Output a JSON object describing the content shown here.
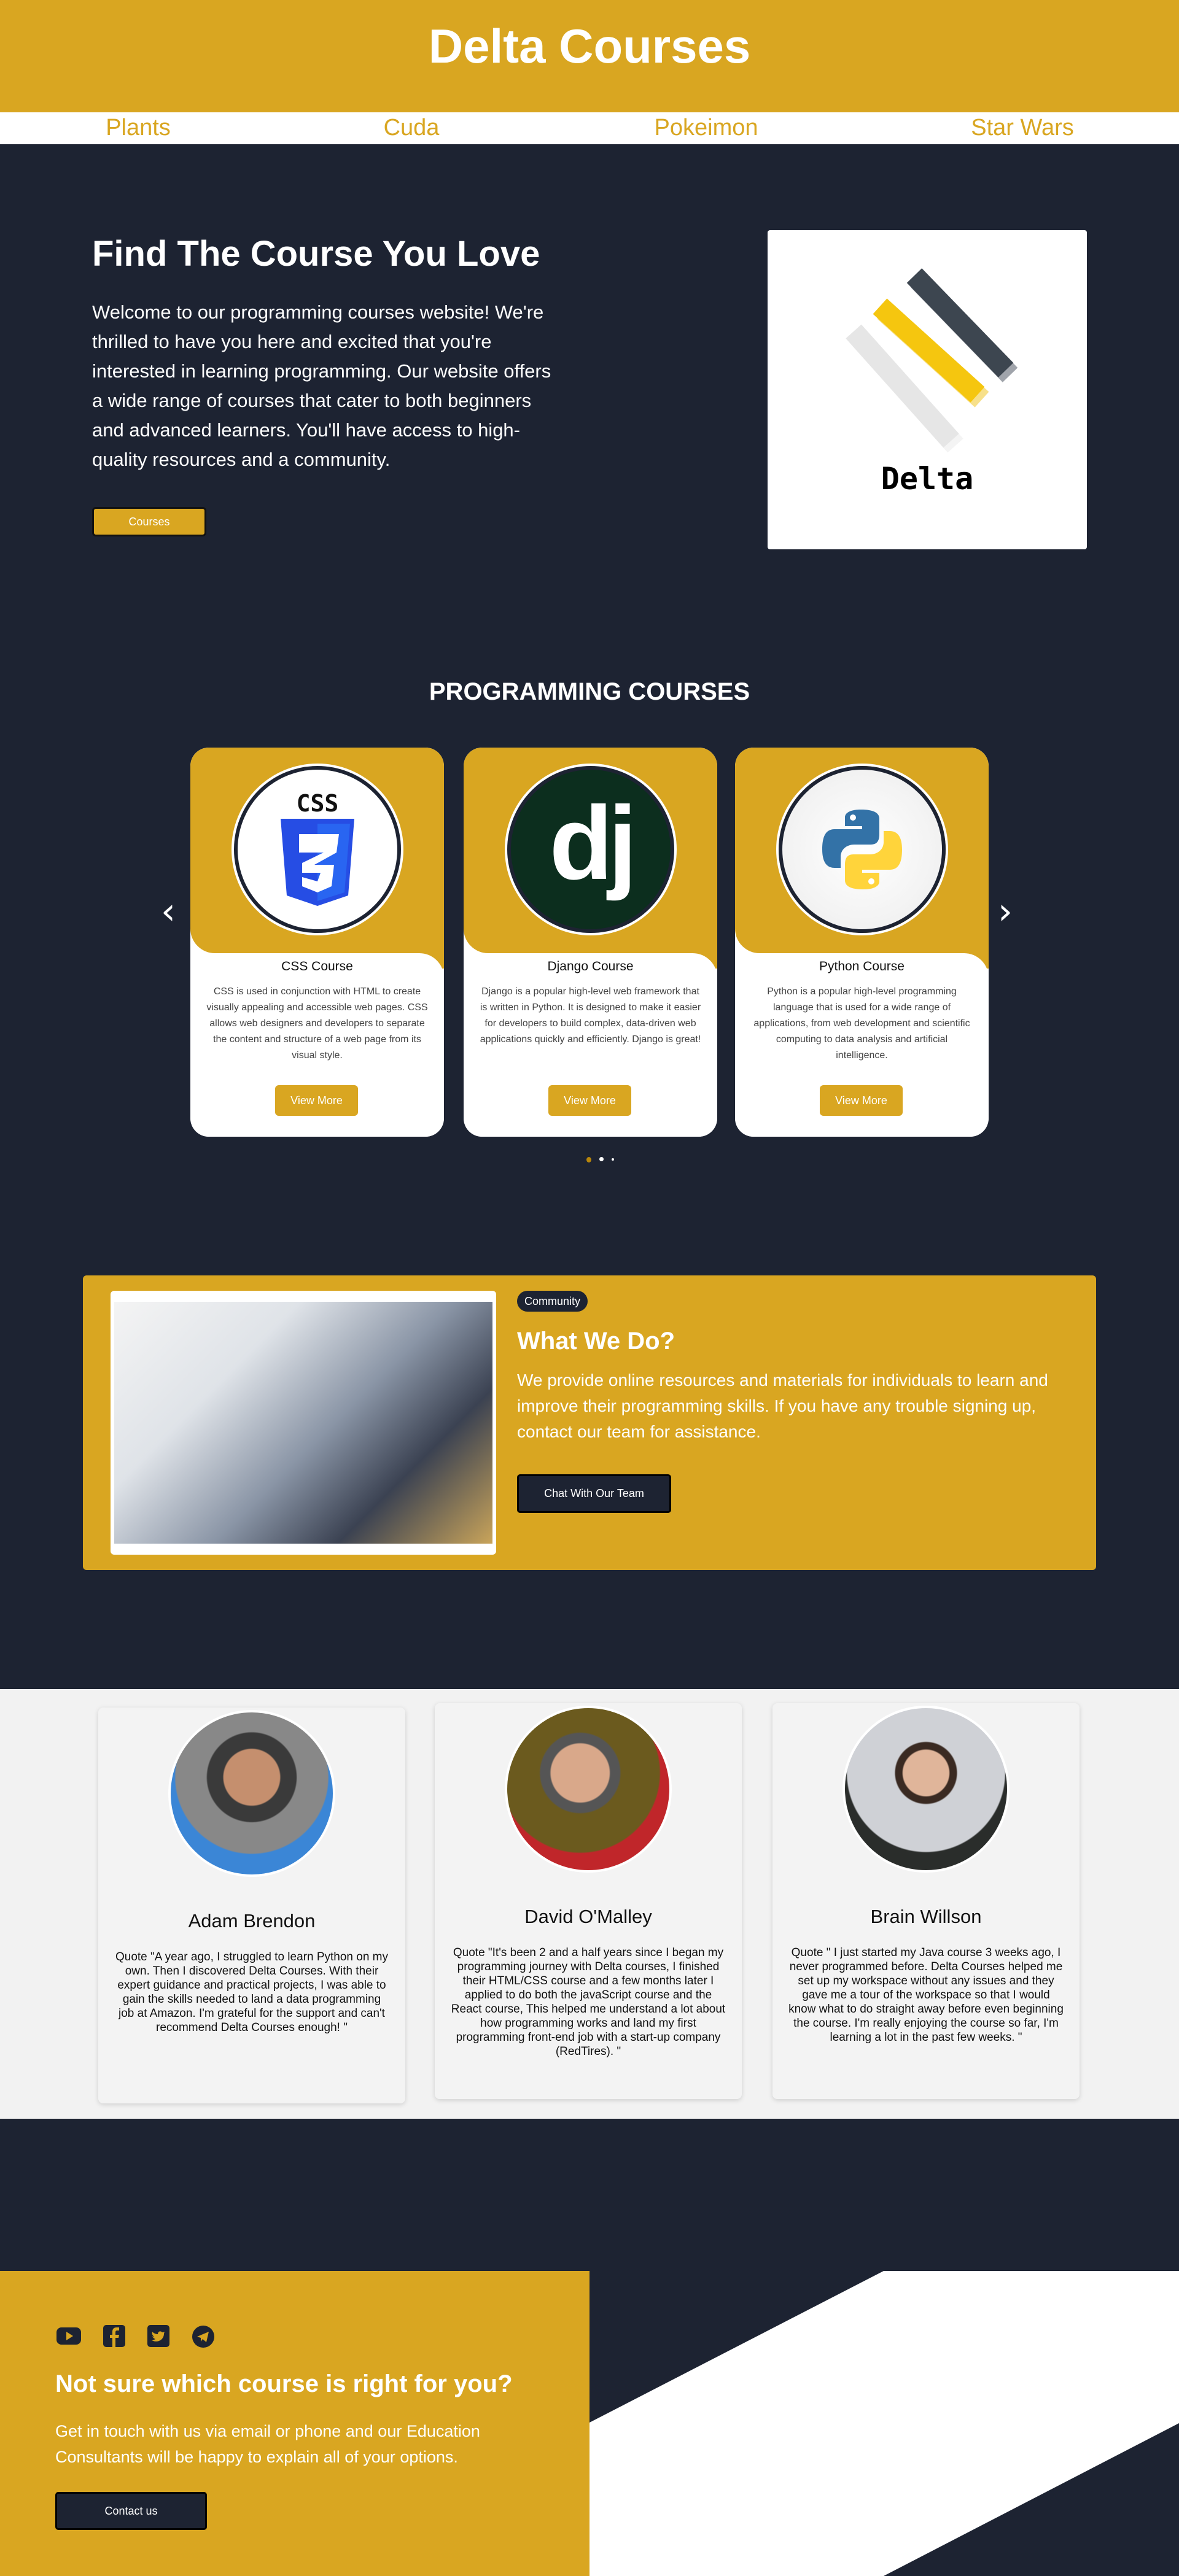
{
  "header": {
    "title": "Delta Courses"
  },
  "nav": {
    "items": [
      {
        "label": "Plants"
      },
      {
        "label": "Cuda"
      },
      {
        "label": "Pokeimon"
      },
      {
        "label": "Star Wars"
      }
    ]
  },
  "hero": {
    "title": "Find The Course You Love",
    "text": "Welcome to our programming courses website! We're thrilled to have you here and excited that you're interested in learning programming. Our website offers a wide range of courses that cater to both beginners and advanced learners. You'll have access to high-quality resources and a community.",
    "button": "Courses",
    "logo_text": "Delta"
  },
  "courses": {
    "title": "PROGRAMMING COURSES",
    "items": [
      {
        "icon": "css3-icon",
        "title": "CSS Course",
        "logo_text": "CSS",
        "desc": "CSS is used in conjunction with HTML to create visually appealing and accessible web pages. CSS allows web designers and developers to separate the content and structure of a web page from its visual style.",
        "button": "View More"
      },
      {
        "icon": "django-icon",
        "title": "Django Course",
        "logo_text": "dj",
        "desc": "Django is a popular high-level web framework that is written in Python. It is designed to make it easier for developers to build complex, data-driven web applications quickly and efficiently. Django is great!",
        "button": "View More"
      },
      {
        "icon": "python-icon",
        "title": "Python Course",
        "desc": "Python is a popular high-level programming language that is used for a wide range of applications, from web development and scientific computing to data analysis and artificial intelligence.",
        "button": "View More"
      }
    ],
    "active_dot": 0
  },
  "community": {
    "badge": "Community",
    "title": "What We Do?",
    "text": "We provide online resources and materials for individuals to learn and improve their programming skills. If you have any trouble signing up, contact our team for assistance.",
    "button": "Chat With Our Team"
  },
  "testimonials": [
    {
      "name": "Adam Brendon",
      "quote": "Quote \"A year ago, I struggled to learn Python on my own. Then I discovered Delta Courses. With their expert guidance and practical projects, I was able to gain the skills needed to land a data programming job at Amazon. I'm grateful for the support and can't recommend Delta Courses enough! \""
    },
    {
      "name": "David O'Malley",
      "quote": "Quote \"It's been 2 and a half years since I began my programming journey with Delta courses, I finished their HTML/CSS course and a few months later I applied to do both the javaScript course and the React course, This helped me understand a lot about how programming works and land my first programming front-end job with a start-up company (RedTires). \""
    },
    {
      "name": "Brain Willson",
      "quote": "Quote \" I just started my Java course 3 weeks ago, I never programmed before. Delta Courses helped me set up my workspace without any issues and they gave me a tour of the workspace so that I would know what to do straight away before even beginning the course. I'm really enjoying the course so far, I'm learning a lot in the past few weeks. \""
    }
  ],
  "cta": {
    "socials": [
      "youtube-icon",
      "facebook-icon",
      "twitter-icon",
      "telegram-icon"
    ],
    "title": "Not sure which course is right for you?",
    "text": "Get in touch with us via email or phone and our Education Consultants will be happy to explain all of your options.",
    "button": "Contact us"
  },
  "colors": {
    "brand": "#d9a621",
    "dark": "#1d2332",
    "light": "#f2f2f2"
  }
}
